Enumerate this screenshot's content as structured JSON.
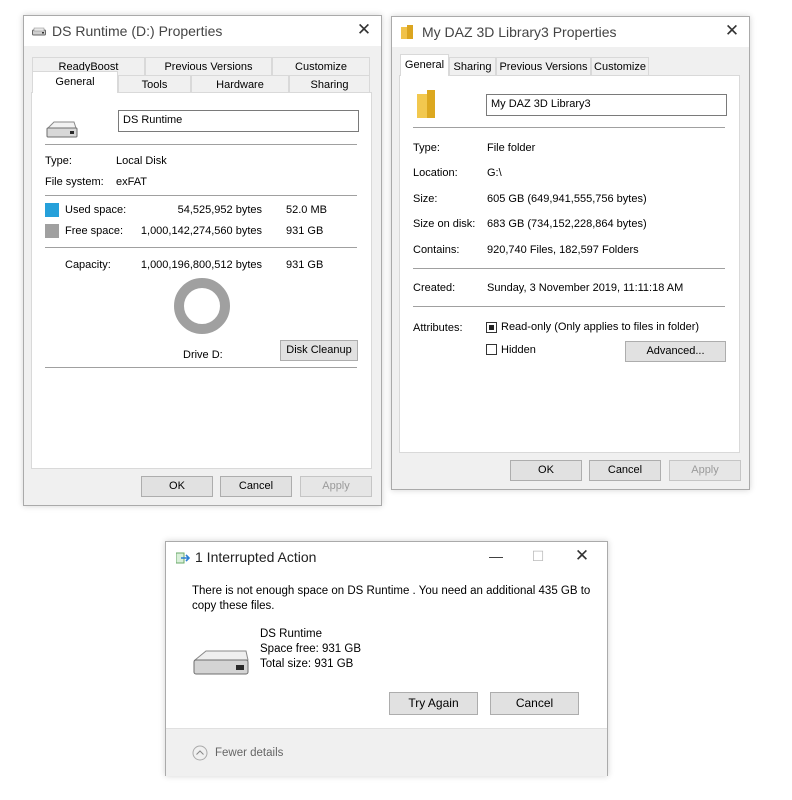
{
  "drive_dialog": {
    "title": "DS Runtime  (D:) Properties",
    "tabs_row1": [
      "ReadyBoost",
      "Previous Versions",
      "Customize"
    ],
    "tabs_row2": [
      "General",
      "Tools",
      "Hardware",
      "Sharing"
    ],
    "name_value": "DS Runtime",
    "type_label": "Type:",
    "type_value": "Local Disk",
    "fs_label": "File system:",
    "fs_value": "exFAT",
    "used_label": "Used space:",
    "used_bytes": "54,525,952 bytes",
    "used_size": "52.0 MB",
    "free_label": "Free space:",
    "free_bytes": "1,000,142,274,560 bytes",
    "free_size": "931 GB",
    "capacity_label": "Capacity:",
    "capacity_bytes": "1,000,196,800,512 bytes",
    "capacity_size": "931 GB",
    "drive_label": "Drive D:",
    "cleanup_label": "Disk Cleanup",
    "ok": "OK",
    "cancel": "Cancel",
    "apply": "Apply",
    "colors": {
      "used": "#26a0da",
      "free": "#a0a0a0"
    }
  },
  "folder_dialog": {
    "title": "My DAZ 3D Library3 Properties",
    "tabs": [
      "General",
      "Sharing",
      "Previous Versions",
      "Customize"
    ],
    "name_value": "My DAZ 3D Library3",
    "rows": [
      {
        "label": "Type:",
        "value": "File folder"
      },
      {
        "label": "Location:",
        "value": "G:\\"
      },
      {
        "label": "Size:",
        "value": "605 GB (649,941,555,756 bytes)"
      },
      {
        "label": "Size on disk:",
        "value": "683 GB (734,152,228,864 bytes)"
      },
      {
        "label": "Contains:",
        "value": "920,740 Files, 182,597 Folders"
      }
    ],
    "created_label": "Created:",
    "created_value": "Sunday, 3 November 2019, 11:11:18 AM",
    "attributes_label": "Attributes:",
    "readonly_label": "Read-only (Only applies to files in folder)",
    "hidden_label": "Hidden",
    "advanced_label": "Advanced...",
    "ok": "OK",
    "cancel": "Cancel",
    "apply": "Apply"
  },
  "interrupt_dialog": {
    "title": "1 Interrupted Action",
    "message": "There is not enough space on DS Runtime . You need an additional 435 GB to copy these files.",
    "drive_name": "DS Runtime",
    "space_free": "Space free: 931 GB",
    "total_size": "Total size: 931 GB",
    "try_again": "Try Again",
    "cancel": "Cancel",
    "fewer_details": "Fewer details"
  }
}
